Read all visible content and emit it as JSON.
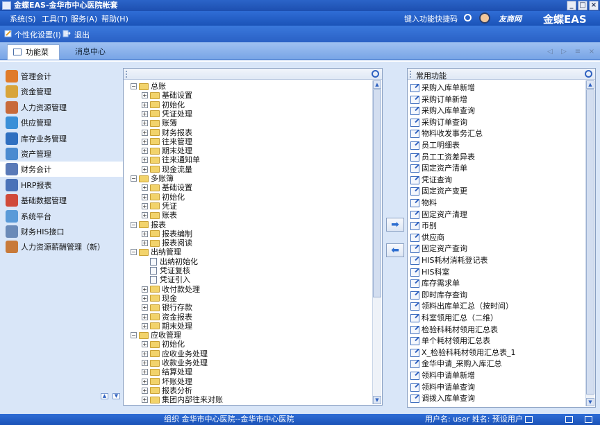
{
  "window": {
    "title": "金蝶EAS-金华市中心医院帐套",
    "buttons": [
      "_",
      "□",
      "×"
    ]
  },
  "menubar": {
    "items": [
      "系统(S)",
      "工具(T)",
      "服务(A)",
      "帮助(H)"
    ],
    "quick_code": "键入功能快捷码",
    "portal_logo": "友商网",
    "brand": "金蝶EAS"
  },
  "toolbar": {
    "personalize": "个性化设置(I)",
    "logout": "退出"
  },
  "tabs": {
    "function_menu": "功能菜单",
    "message_center": "消息中心"
  },
  "tab_nav": [
    "◁",
    "▷",
    "≡",
    "×"
  ],
  "sidebar": {
    "items": [
      {
        "label": "管理会计",
        "color": "#e07b2a"
      },
      {
        "label": "资金管理",
        "color": "#d8a43a"
      },
      {
        "label": "人力资源管理",
        "color": "#c86a3a"
      },
      {
        "label": "供应管理",
        "color": "#3a8fd8"
      },
      {
        "label": "库存业务管理",
        "color": "#2f6fc0"
      },
      {
        "label": "资产管理",
        "color": "#4a8ad0"
      },
      {
        "label": "财务会计",
        "color": "#5a7ab8"
      },
      {
        "label": "HRP报表",
        "color": "#4a72b8"
      },
      {
        "label": "基础数据管理",
        "color": "#d04a3a"
      },
      {
        "label": "系统平台",
        "color": "#5a9ad8"
      },
      {
        "label": "财务HIS接口",
        "color": "#6a8ab8"
      },
      {
        "label": "人力资源薪酬管理（新）",
        "color": "#c87a3a"
      }
    ],
    "active_index": 6,
    "scroll_up": "▲",
    "scroll_down": "▼"
  },
  "tree": {
    "rows": [
      {
        "label": "总账",
        "level": 0,
        "type": "folder",
        "expander": "−"
      },
      {
        "label": "基础设置",
        "level": 1,
        "type": "folder",
        "expander": "+"
      },
      {
        "label": "初始化",
        "level": 1,
        "type": "folder",
        "expander": "+"
      },
      {
        "label": "凭证处理",
        "level": 1,
        "type": "folder",
        "expander": "+"
      },
      {
        "label": "账簿",
        "level": 1,
        "type": "folder",
        "expander": "+"
      },
      {
        "label": "财务报表",
        "level": 1,
        "type": "folder",
        "expander": "+"
      },
      {
        "label": "往来管理",
        "level": 1,
        "type": "folder",
        "expander": "+"
      },
      {
        "label": "期末处理",
        "level": 1,
        "type": "folder",
        "expander": "+"
      },
      {
        "label": "往来通知单",
        "level": 1,
        "type": "folder",
        "expander": "+"
      },
      {
        "label": "现金流量",
        "level": 1,
        "type": "folder",
        "expander": "+"
      },
      {
        "label": "多账簿",
        "level": 0,
        "type": "folder",
        "expander": "−"
      },
      {
        "label": "基础设置",
        "level": 1,
        "type": "folder",
        "expander": "+"
      },
      {
        "label": "初始化",
        "level": 1,
        "type": "folder",
        "expander": "+"
      },
      {
        "label": "凭证",
        "level": 1,
        "type": "folder",
        "expander": "+"
      },
      {
        "label": "账表",
        "level": 1,
        "type": "folder",
        "expander": "+"
      },
      {
        "label": "报表",
        "level": 0,
        "type": "folder",
        "expander": "−"
      },
      {
        "label": "报表编制",
        "level": 1,
        "type": "folder",
        "expander": "+"
      },
      {
        "label": "报表阅读",
        "level": 1,
        "type": "folder",
        "expander": "+"
      },
      {
        "label": "出纳管理",
        "level": 0,
        "type": "folder",
        "expander": "−"
      },
      {
        "label": "出纳初始化",
        "level": 1,
        "type": "doc",
        "expander": ""
      },
      {
        "label": "凭证复核",
        "level": 1,
        "type": "doc",
        "expander": ""
      },
      {
        "label": "凭证引入",
        "level": 1,
        "type": "doc",
        "expander": ""
      },
      {
        "label": "收付款处理",
        "level": 1,
        "type": "folder",
        "expander": "+"
      },
      {
        "label": "现金",
        "level": 1,
        "type": "folder",
        "expander": "+"
      },
      {
        "label": "银行存款",
        "level": 1,
        "type": "folder",
        "expander": "+"
      },
      {
        "label": "资金报表",
        "level": 1,
        "type": "folder",
        "expander": "+"
      },
      {
        "label": "期末处理",
        "level": 1,
        "type": "folder",
        "expander": "+"
      },
      {
        "label": "应收管理",
        "level": 0,
        "type": "folder",
        "expander": "−"
      },
      {
        "label": "初始化",
        "level": 1,
        "type": "folder",
        "expander": "+"
      },
      {
        "label": "应收业务处理",
        "level": 1,
        "type": "folder",
        "expander": "+"
      },
      {
        "label": "收款业务处理",
        "level": 1,
        "type": "folder",
        "expander": "+"
      },
      {
        "label": "结算处理",
        "level": 1,
        "type": "folder",
        "expander": "+"
      },
      {
        "label": "坏账处理",
        "level": 1,
        "type": "folder",
        "expander": "+"
      },
      {
        "label": "报表分析",
        "level": 1,
        "type": "folder",
        "expander": "+"
      },
      {
        "label": "集团内部往来对账",
        "level": 1,
        "type": "folder",
        "expander": "+"
      }
    ],
    "scroll_up": "▲",
    "scroll_down": "▼"
  },
  "transfer": {
    "add": "➡",
    "remove": "⬅"
  },
  "favorites": {
    "title": "常用功能",
    "items": [
      "采购入库单新增",
      "采购订单新增",
      "采购入库单查询",
      "采购订单查询",
      "物料收发事务汇总",
      "员工明细表",
      "员工工资差异表",
      "固定资产清单",
      "凭证查询",
      "固定资产变更",
      "物料",
      "固定资产清理",
      "币别",
      "供应商",
      "固定资产查询",
      "HIS耗材消耗登记表",
      "HIS科室",
      "库存需求单",
      "即时库存查询",
      "领料出库单汇总（按时间）",
      "科室领用汇总（二维）",
      "检验科耗材领用汇总表",
      "单个耗材领用汇总表",
      "X_检验科耗材领用汇总表_1",
      "金华申请_采购入库汇总",
      "领料申请单新增",
      "领料申请单查询",
      "调拨入库单查询"
    ],
    "scroll_up": "▲",
    "scroll_down": "▼"
  },
  "status": {
    "org": "组织 金华市中心医院--金华市中心医院",
    "user": "用户名: user 姓名: 预设用户"
  }
}
